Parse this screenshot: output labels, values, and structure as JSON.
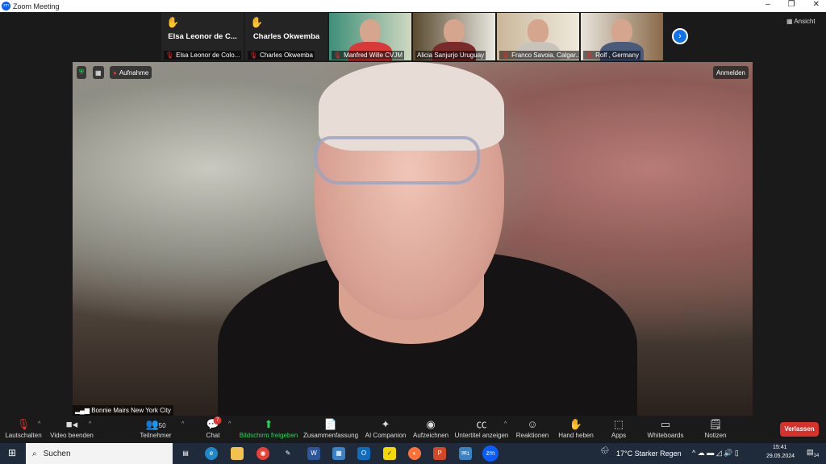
{
  "window": {
    "title": "Zoom Meeting",
    "minimize": "–",
    "restore": "❐",
    "close": "✕"
  },
  "gallery": {
    "tiles": [
      {
        "name": "Elsa Leonor de Colo...",
        "big": "Elsa Leonor de C...",
        "hand": true
      },
      {
        "name": "Charles Okwemba",
        "big": "Charles Okwemba",
        "hand": true
      },
      {
        "name": "Manfred Wille CVJM"
      },
      {
        "name": "Alicia Sanjurjo Uruguay"
      },
      {
        "name": "Franco Savoia, Calgar..."
      },
      {
        "name": "Rolf , Germany"
      }
    ],
    "next": "›",
    "view_label": "Ansicht"
  },
  "main": {
    "record_label": "Aufnahme",
    "signin_label": "Anmelden",
    "speaker": "Bonnie Mairs New York City"
  },
  "toolbar": {
    "mute": "Lautschalten",
    "video": "Video beenden",
    "participants": "Teilnehmer",
    "participants_count": "50",
    "chat": "Chat",
    "chat_badge": "7",
    "share": "Bildschirm freigeben",
    "summary": "Zusammenfassung",
    "ai": "AI Companion",
    "record": "Aufzeichnen",
    "captions": "Untertitel anzeigen",
    "reactions": "Reaktionen",
    "raise_hand": "Hand heben",
    "apps": "Apps",
    "whiteboards": "Whiteboards",
    "notes": "Notizen",
    "leave": "Verlassen"
  },
  "taskbar": {
    "search": "Suchen",
    "weather": "17°C  Starker Regen",
    "time": "15:41",
    "date": "29.05.2024",
    "notifications": "14",
    "mail_badge": "1"
  }
}
